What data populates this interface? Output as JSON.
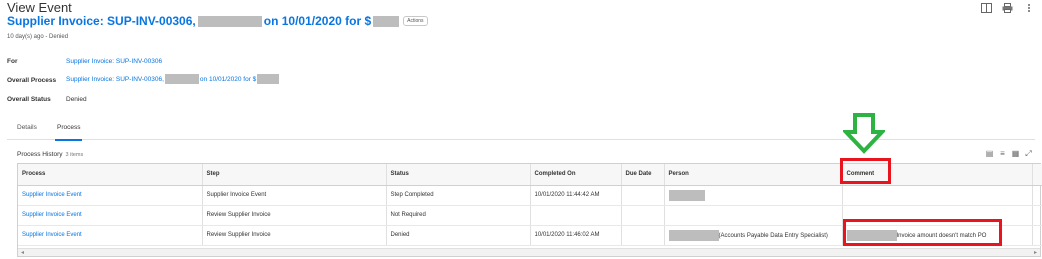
{
  "header": {
    "title": "View Event",
    "subtitle_prefix": "Supplier Invoice: SUP-INV-00306,",
    "subtitle_middle": "on 10/01/2020 for $",
    "actions_label": "Actions",
    "time_ago": "10 day(s) ago - Denied"
  },
  "top_icons": [
    "excel-export-icon",
    "print-icon",
    "more-icon"
  ],
  "fields": {
    "for_label": "For",
    "for_value": "Supplier Invoice: SUP-INV-00306",
    "overall_process_label": "Overall Process",
    "overall_process_prefix": "Supplier Invoice: SUP-INV-00306,",
    "overall_process_middle": "on 10/01/2020 for $",
    "overall_status_label": "Overall Status",
    "overall_status_value": "Denied"
  },
  "tabs": [
    {
      "label": "Details",
      "active": false
    },
    {
      "label": "Process",
      "active": true
    }
  ],
  "process_history": {
    "title": "Process History",
    "count": "3 items",
    "columns": [
      "Process",
      "Step",
      "Status",
      "Completed On",
      "Due Date",
      "Person",
      "Comment"
    ],
    "rows": [
      {
        "process": "Supplier Invoice Event",
        "step": "Supplier Invoice Event",
        "status": "Step Completed",
        "completed_on": "10/01/2020 11:44:42 AM",
        "due_date": "",
        "person": "",
        "comment": ""
      },
      {
        "process": "Supplier Invoice Event",
        "step": "Review Supplier Invoice",
        "status": "Not Required",
        "completed_on": "",
        "due_date": "",
        "person": "",
        "comment": ""
      },
      {
        "process": "Supplier Invoice Event",
        "step": "Review Supplier Invoice",
        "status": "Denied",
        "completed_on": "10/01/2020 11:46:02 AM",
        "due_date": "",
        "person": "(Accounts Payable Data Entry Specialist)",
        "comment": "Invoice amount doesn't match PO"
      }
    ]
  },
  "colors": {
    "link": "#0875e1",
    "highlight": "#e8141e",
    "arrow": "#2db341",
    "redaction": "#bdbdbd"
  }
}
